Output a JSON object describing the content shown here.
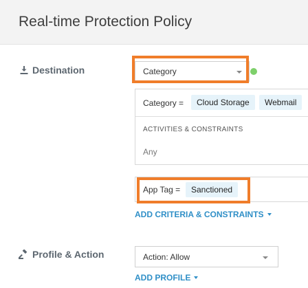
{
  "page": {
    "title": "Real-time Protection Policy"
  },
  "destination": {
    "label": "Destination",
    "icon": "download-icon",
    "selector": {
      "value": "Category"
    },
    "status_color": "#7ed06b",
    "criteria": {
      "category_label": "Category =",
      "categories": [
        "Cloud Storage",
        "Webmail"
      ],
      "activities_heading": "ACTIVITIES & CONSTRAINTS",
      "activities_value": "Any"
    },
    "app_tag": {
      "label": "App Tag =",
      "value": "Sanctioned"
    },
    "add_criteria_label": "ADD CRITERIA & CONSTRAINTS"
  },
  "profile_action": {
    "label": "Profile & Action",
    "icon": "gavel-icon",
    "action_prefix": "Action:",
    "action_value": "Allow",
    "add_profile_label": "ADD PROFILE"
  },
  "colors": {
    "accent": "#2f8fc7",
    "highlight": "#f07d2a",
    "chip_bg": "#e6f3fa"
  }
}
